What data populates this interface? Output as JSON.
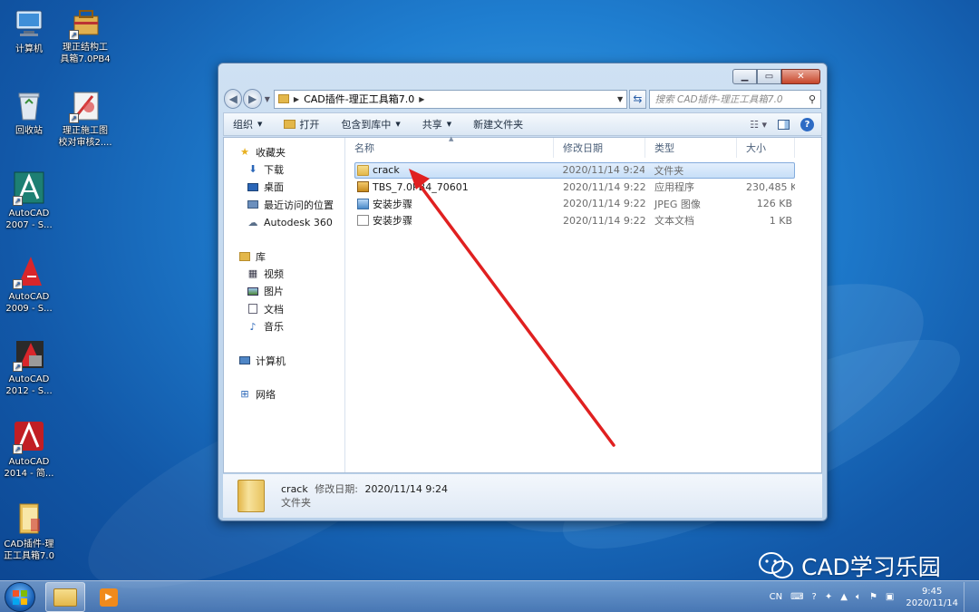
{
  "desktop": {
    "icons": [
      {
        "label_line1": "计算机",
        "label_line2": "",
        "icon": "computer-icon"
      },
      {
        "label_line1": "理正结构工",
        "label_line2": "具箱7.0PB4",
        "icon": "toolbox-icon"
      },
      {
        "label_line1": "回收站",
        "label_line2": "",
        "icon": "recycle-bin-icon"
      },
      {
        "label_line1": "理正施工图",
        "label_line2": "校对审核2....",
        "icon": "drawing-icon"
      },
      {
        "label_line1": "AutoCAD",
        "label_line2": "2007 - S...",
        "icon": "autocad-2007-icon"
      },
      {
        "label_line1": "AutoCAD",
        "label_line2": "2009 - S...",
        "icon": "autocad-2009-icon"
      },
      {
        "label_line1": "AutoCAD",
        "label_line2": "2012 - S...",
        "icon": "autocad-2012-icon"
      },
      {
        "label_line1": "AutoCAD",
        "label_line2": "2014 - 简...",
        "icon": "autocad-2014-icon"
      },
      {
        "label_line1": "CAD插件-理",
        "label_line2": "正工具箱7.0",
        "icon": "folder-icon"
      }
    ]
  },
  "explorer": {
    "address": {
      "crumb": "CAD插件-理正工具箱7.0"
    },
    "search_placeholder": "搜索 CAD插件-理正工具箱7.0",
    "toolbar": {
      "organize": "组织",
      "open": "打开",
      "include_in_library": "包含到库中",
      "share": "共享",
      "new_folder": "新建文件夹"
    },
    "nav": {
      "favorites": "收藏夹",
      "favorites_items": [
        "下载",
        "桌面",
        "最近访问的位置",
        "Autodesk 360"
      ],
      "libraries": "库",
      "library_items": [
        "视频",
        "图片",
        "文档",
        "音乐"
      ],
      "computer": "计算机",
      "network": "网络"
    },
    "columns": {
      "name": "名称",
      "date": "修改日期",
      "type": "类型",
      "size": "大小"
    },
    "files": [
      {
        "name": "crack",
        "date": "2020/11/14 9:24",
        "type": "文件夹",
        "size": "",
        "icon": "folder"
      },
      {
        "name": "TBS_7.0PB4_70601",
        "date": "2020/11/14 9:22",
        "type": "应用程序",
        "size": "230,485 KB",
        "icon": "exe"
      },
      {
        "name": "安装步骤",
        "date": "2020/11/14 9:22",
        "type": "JPEG 图像",
        "size": "126 KB",
        "icon": "jpg"
      },
      {
        "name": "安装步骤",
        "date": "2020/11/14 9:22",
        "type": "文本文档",
        "size": "1 KB",
        "icon": "txt"
      }
    ],
    "details": {
      "name": "crack",
      "modified_label": "修改日期:",
      "modified_value": "2020/11/14 9:24",
      "type": "文件夹"
    }
  },
  "watermark": {
    "text": "CAD学习乐园"
  },
  "taskbar": {
    "lang": "CN",
    "time": "9:45",
    "date": "2020/11/14"
  }
}
